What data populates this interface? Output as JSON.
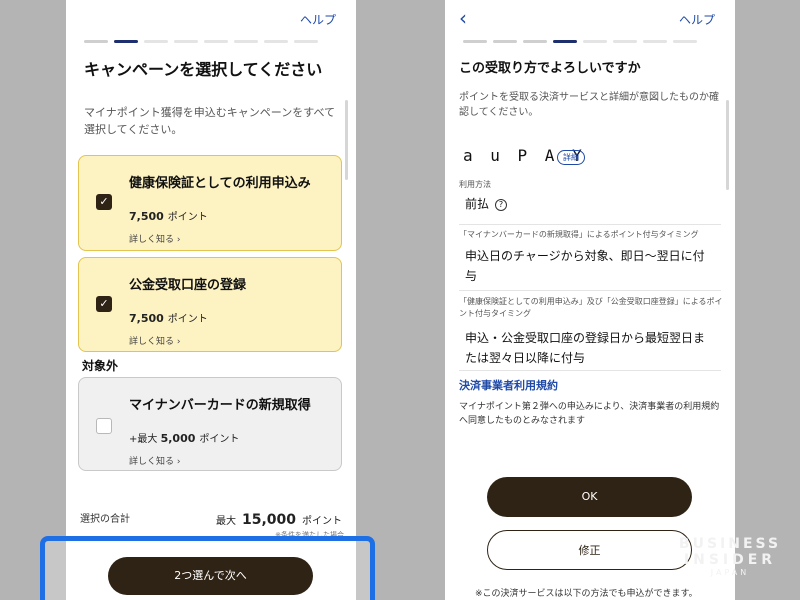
{
  "left": {
    "help": "ヘルプ",
    "title": "キャンペーンを選択してください",
    "description": "マイナポイント獲得を申込むキャンペーンをすべて選択してください。",
    "campaigns": [
      {
        "name": "健康保険証としての利用申込み",
        "points": "7,500",
        "unit": "ポイント",
        "more": "詳しく知る ›",
        "checked": true
      },
      {
        "name": "公金受取口座の登録",
        "points": "7,500",
        "unit": "ポイント",
        "more": "詳しく知る ›",
        "checked": true
      }
    ],
    "excluded_label": "対象外",
    "excluded": {
      "name": "マイナンバーカードの新規取得",
      "prefix": "+最大",
      "points": "5,000",
      "unit": "ポイント",
      "more": "詳しく知る ›"
    },
    "total_label": "選択の合計",
    "total_prefix": "最大",
    "total_points": "15,000",
    "total_unit": "ポイント",
    "total_note": "※条件を満たした場合",
    "next_button": "2つ選んで次へ"
  },
  "right": {
    "help": "ヘルプ",
    "title": "この受取り方でよろしいですか",
    "description": "ポイントを受取る決済サービスと詳細が意図したものか確認してください。",
    "service_name": "a u  P A Y",
    "detail_badge": "詳細",
    "usage_label": "利用方法",
    "usage_value": "前払",
    "timing1_label": "「マイナンバーカードの新規取得」によるポイント付与タイミング",
    "timing1_value": "申込日のチャージから対象、即日〜翌日に付与",
    "timing2_label": "「健康保険証としての利用申込み」及び「公金受取口座登録」によるポイント付与タイミング",
    "timing2_value": "申込・公金受取口座の登録日から最短翌日または翌々日以降に付与",
    "terms_link": "決済事業者利用規約",
    "agreement": "マイナポイント第２弾への申込みにより、決済事業者の利用規約へ同意したものとみなされます",
    "ok_button": "OK",
    "edit_button": "修正",
    "bottom_note": "※この決済サービスは以下の方法でも申込ができます。"
  },
  "watermark": {
    "line1": "BUSINESS",
    "line2": "INSIDER",
    "line3": "JAPAN"
  },
  "colors": {
    "accent_blue": "#1f4aa8",
    "highlight_blue": "#1e6fe6",
    "dark_button": "#2e2314",
    "card_selected": "#fdf2c2"
  }
}
